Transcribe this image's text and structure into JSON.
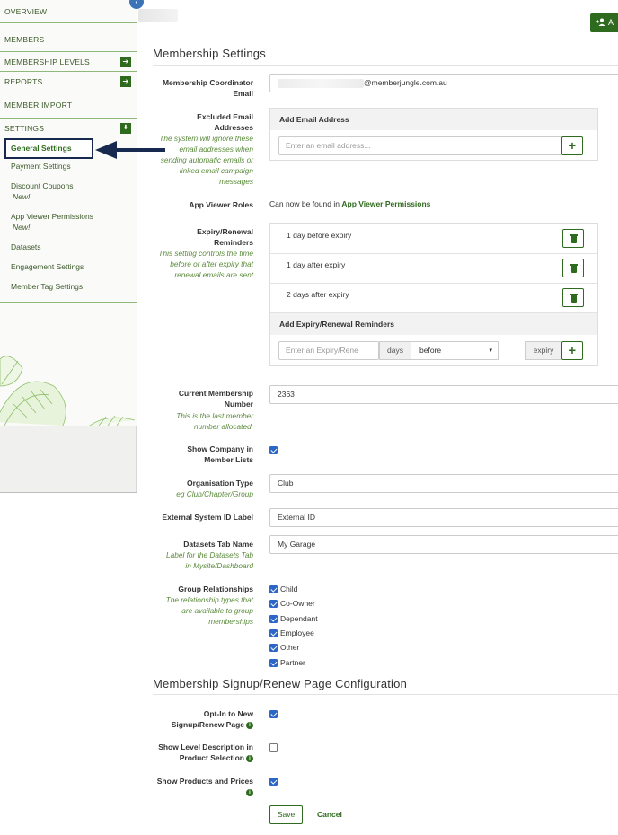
{
  "sidebar": {
    "overview": "OVERVIEW",
    "members": "MEMBERS",
    "membership_levels": "MEMBERSHIP LEVELS",
    "reports": "REPORTS",
    "member_import": "MEMBER IMPORT",
    "settings": "SETTINGS",
    "sub_items": {
      "general": "General Settings",
      "payment": "Payment Settings",
      "discount": "Discount Coupons",
      "app_viewer": "App Viewer Permissions",
      "datasets": "Datasets",
      "engagement": "Engagement Settings",
      "member_tag": "Member Tag Settings"
    },
    "new_badge": "New!",
    "arrow_right": "➔",
    "arrow_down": "⬇"
  },
  "header": {
    "add_button": "A"
  },
  "membership_settings": {
    "title": "Membership Settings",
    "coordinator": {
      "label": "Membership Coordinator Email",
      "value_suffix": "@memberjungle.com.au"
    },
    "excluded": {
      "label": "Excluded Email Addresses",
      "help": "The system will ignore these email addresses when sending automatic emails or linked email campaign messages",
      "panel_title": "Add Email Address",
      "placeholder": "Enter an email address..."
    },
    "app_viewer_roles": {
      "label": "App Viewer Roles",
      "text": "Can now be found in",
      "link": "App Viewer Permissions"
    },
    "reminders": {
      "label": "Expiry/Renewal Reminders",
      "help": "This setting controls the time before or after expiry that renewal emails are sent",
      "items": [
        "1 day before expiry",
        "1 day after expiry",
        "2 days after expiry"
      ],
      "add_title": "Add Expiry/Renewal Reminders",
      "placeholder": "Enter an Expiry/Rene",
      "days": "days",
      "when": "before",
      "expiry": "expiry"
    },
    "current_number": {
      "label": "Current Membership Number",
      "help": "This is the last member number allocated.",
      "value": "2363"
    },
    "show_company": {
      "label": "Show Company in Member Lists",
      "checked": true
    },
    "org_type": {
      "label": "Organisation Type",
      "help": "eg Club/Chapter/Group",
      "value": "Club"
    },
    "external_id": {
      "label": "External System ID Label",
      "value": "External ID"
    },
    "datasets_tab": {
      "label": "Datasets Tab Name",
      "help": "Label for the Datasets Tab in Mysite/Dashboard",
      "value": "My Garage"
    },
    "relationships": {
      "label": "Group Relationships",
      "help": "The relationship types that are available to group memberships",
      "items": [
        "Child",
        "Co-Owner",
        "Dependant",
        "Employee",
        "Other",
        "Partner"
      ]
    }
  },
  "signup_config": {
    "title": "Membership Signup/Renew Page Configuration",
    "opt_in": {
      "label": "Opt-In to New Signup/Renew Page",
      "checked": true
    },
    "level_desc": {
      "label": "Show Level Description in Product Selection",
      "checked": false
    },
    "products_prices": {
      "label": "Show Products and Prices",
      "checked": true
    }
  },
  "actions": {
    "save": "Save",
    "cancel": "Cancel"
  },
  "colors": {
    "accent": "#2f6b1e",
    "help_text": "#5a8a3a",
    "checkbox": "#2c66c6",
    "annotation": "#18294f"
  }
}
